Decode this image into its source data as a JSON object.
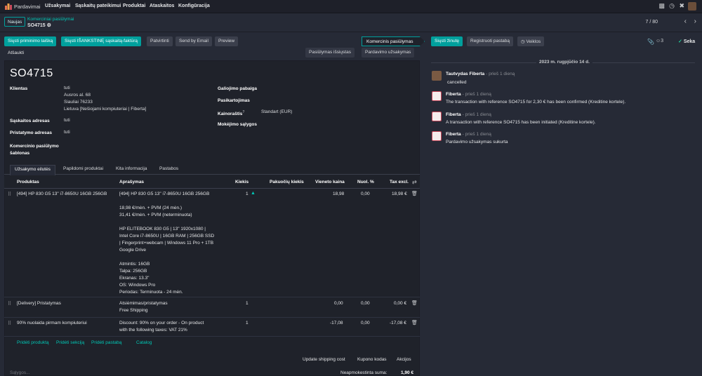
{
  "nav": {
    "app_name": "Pardavimai",
    "menu": [
      "Užsakymai",
      "Sąskaitų pateikimui",
      "Produktai",
      "Ataskaitos",
      "Konfigūracija"
    ]
  },
  "control": {
    "new_label": "Naujas",
    "breadcrumb_parent": "Komerciniai pasiūlymai",
    "breadcrumb_current": "SO4715",
    "pager": "7 / 80"
  },
  "actions": {
    "send_reminder": "Siųsti priminimo laišką",
    "send_advance": "Siųsti IŠANKSTINĘ sąskaitą-faktūrą",
    "confirm": "Patvirtinti",
    "send_email": "Send by Email",
    "preview": "Preview",
    "cancel": "Atšaukti",
    "status_quotation_sent": "Pasiūlymas išsiųstas",
    "status_sales_order": "Pardavimo užsakymas",
    "status_active": "Komercinis pasiūlymas"
  },
  "chatter_bar": {
    "send_message": "Siųsti žinutę",
    "log_note": "Registruoti pastabą",
    "activities": "Veiklos",
    "followers_count": "3",
    "follow": "Seka"
  },
  "form": {
    "name": "SO4715",
    "client_label": "Klientas",
    "client_name": "tuti",
    "client_address_1": "Ausros al. 68",
    "client_address_2": "Siauliai 76233",
    "client_address_3": "Lietuva [Nešiojami kompiuteriai | Fiberta]",
    "invoice_address_label": "Sąskaitos adresas",
    "invoice_address": "tuti",
    "delivery_address_label": "Pristatymo adresas",
    "delivery_address": "tuti",
    "template_label": "Komercinio pasiūlymo šablonas",
    "validity_label": "Galiojimo pabaiga",
    "recurrence_label": "Pasikartojimas",
    "pricelist_label": "Kainoraštis",
    "pricelist_sup": "?",
    "pricelist_value": "Standart (EUR)",
    "payment_terms_label": "Mokėjimo sąlygos"
  },
  "tabs": [
    "Užsakymo eilutės",
    "Papildomi produktai",
    "Kita informacija",
    "Pastabos"
  ],
  "table": {
    "headers": [
      "Produktas",
      "Aprašymas",
      "Kiekis",
      "Pakuočių kiekis",
      "Vieneto kaina",
      "Nuol. %",
      "Tax excl."
    ],
    "rows": [
      {
        "product": "[494] HP 830 G5 13\" i7-8650U 16GB 256GB",
        "description": [
          "[494] HP 830 G5 13\" i7-8650U 16GB 256GB",
          "",
          "18,98 €/mėn. + PVM (24 mėn.)",
          "31,41 €/mėn. + PVM (neterminuota)",
          "",
          "HP ELITEBOOK 830 G5 | 13\" 1920x1080 |",
          "Intel Core i7-8650U | 16GB RAM | 256GB SSD",
          "| Fingerprint+webcam | Windows 11 Pro + 1TB",
          "Google Drive",
          "",
          "Atmintis: 16GB",
          "Talpa: 256GB",
          "Ekranas: 13.3\"",
          "OS: Windows Pro",
          "Periodas: Terminuota - 24 mėn."
        ],
        "qty": "1",
        "unit_price": "18,98",
        "discount": "0,00",
        "subtotal": "18,98 €"
      },
      {
        "product": "[Delivery] Pristatymas",
        "description": [
          "Atsiėmimas/pristatymas",
          "Free Shipping"
        ],
        "qty": "1",
        "unit_price": "0,00",
        "discount": "0,00",
        "subtotal": "0,00 €"
      },
      {
        "product": "90% nuolaida pirmam kompiuteriui",
        "description": [
          "Discount: 90% on your order - On product",
          "with the following taxes: VAT 21%"
        ],
        "qty": "1",
        "unit_price": "-17,08",
        "discount": "0,00",
        "subtotal": "-17,08 €"
      }
    ],
    "add_product": "Pridėti produktą",
    "add_section": "Pridėti sekciją",
    "add_note": "Pridėti pastabą",
    "catalog": "Catalog"
  },
  "footer": {
    "update_shipping": "Update shipping cost",
    "coupon": "Kupono kodas",
    "promotions": "Akcijos",
    "terms_placeholder": "Sąlygos...",
    "untaxed_label": "Neapmokestinta suma:",
    "untaxed_value": "1,90 €"
  },
  "chatter": {
    "date_separator": "2023 m. rugpjūčio 14 d.",
    "messages": [
      {
        "author": "Tautvydas Fiberta",
        "time": "- prieš 1 dieną",
        "body": "cancelled"
      },
      {
        "author": "Fiberta",
        "time": "- prieš 1 dieną",
        "body": "The transaction with reference SO4715 for 2,30 € has been confirmed (Kreditine kortele)."
      },
      {
        "author": "Fiberta",
        "time": "- prieš 1 dieną",
        "body": "A transaction with reference SO4715 has been initiated (Kreditine kortele)."
      },
      {
        "author": "Fiberta",
        "time": "- prieš 1 dieną",
        "body": "Pardavimo užsakymas sukurta"
      }
    ]
  },
  "colors": {
    "accent": "#00a09d",
    "background": "#262a36",
    "sheet": "#1f222a",
    "link": "#00c7b5"
  }
}
